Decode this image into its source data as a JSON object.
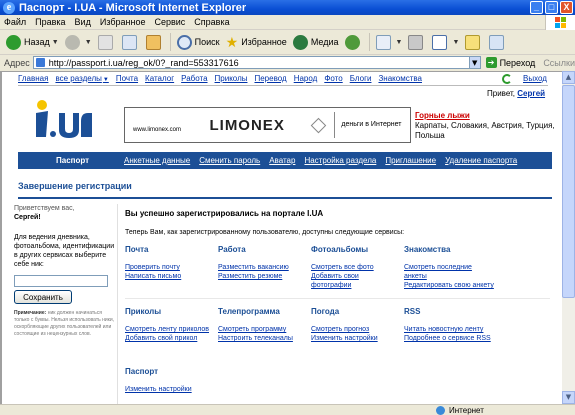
{
  "window": {
    "title": "Паспорт - I.UA - Microsoft Internet Explorer",
    "minimize": "_",
    "maximize": "□",
    "close": "X"
  },
  "menu": [
    "Файл",
    "Правка",
    "Вид",
    "Избранное",
    "Сервис",
    "Справка"
  ],
  "toolbar": {
    "back": "Назад",
    "search": "Поиск",
    "favorites": "Избранное",
    "media": "Медиа"
  },
  "address": {
    "label": "Адрес",
    "url": "http://passport.i.ua/reg_ok/0?_rand=553317616",
    "go": "Переход",
    "links": "Ссылки"
  },
  "status": {
    "text": "",
    "zone": "Интернет"
  },
  "portal": {
    "topnav": [
      "Главная",
      "все разделы",
      "Почта",
      "Каталог",
      "Работа",
      "Приколы",
      "Перевод",
      "Народ",
      "Фото",
      "Блоги",
      "Знакомства"
    ],
    "logout": "Выход",
    "greeting_prefix": "Привет,",
    "greeting_user": "Сергей",
    "banner": {
      "site": "www.limonex.com",
      "brand": "LIMONEX",
      "slogan": "деньги в Интернет"
    },
    "promo": {
      "title": "Горные лыжи",
      "text": "Карпаты, Словакия, Австрия, Турция, Польша"
    },
    "nav": {
      "current": "Паспорт",
      "links": [
        "Анкетные данные",
        "Сменить пароль",
        "Аватар",
        "Настройка раздела",
        "Приглашение",
        "Удаление паспорта"
      ]
    },
    "page_title": "Завершение регистрации"
  },
  "sidebar": {
    "hello": "Приветствуем вас,",
    "user": "Сергей!",
    "hint": "Для ведения дневника, фотоальбома, идентификации в других сервисах выберите себе ник:",
    "nick_value": "",
    "save": "Сохранить",
    "note_label": "Примечание:",
    "note": "ник должен начинаться только с буквы. Нельзя использовать ники, оскорбляющие других пользователей или состоящие из нецензурных слов."
  },
  "main": {
    "success": "Вы успешно зарегистрировались на портале I.UA",
    "subtext": "Теперь Вам, как зарегистрированному пользователю, доступны следующие сервисы:",
    "services": [
      {
        "title": "Почта",
        "links": [
          "Проверить почту",
          "Написать письмо"
        ]
      },
      {
        "title": "Работа",
        "links": [
          "Разместить вакансию",
          "Разместить резюме"
        ]
      },
      {
        "title": "Фотоальбомы",
        "links": [
          "Смотреть все фото",
          "Добавить свои фотографии"
        ]
      },
      {
        "title": "Знакомства",
        "links": [
          "Смотреть последние анкеты",
          "Редактировать свою анкету"
        ]
      },
      {
        "title": "Приколы",
        "links": [
          "Смотреть ленту приколов",
          "Добавить свой прикол"
        ]
      },
      {
        "title": "Телепрограмма",
        "links": [
          "Смотреть программу",
          "Настроить телеканалы"
        ]
      },
      {
        "title": "Погода",
        "links": [
          "Смотреть прогноз",
          "Изменить настройки"
        ]
      },
      {
        "title": "RSS",
        "links": [
          "Читать новостную ленту",
          "Подробнее о сервисе RSS"
        ]
      },
      {
        "title": "Паспорт",
        "links": [
          "Изменить настройки"
        ]
      }
    ]
  },
  "colors": {
    "nav_blue": "#1c4f96",
    "link": "#0033aa",
    "promo_red": "#cc0000"
  }
}
